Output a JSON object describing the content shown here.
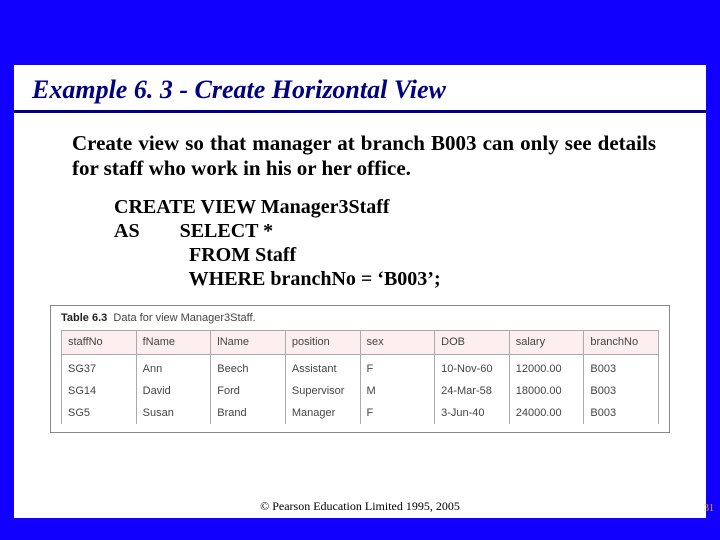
{
  "title": "Example 6. 3 - Create Horizontal View",
  "description": "Create view so that manager at branch B003 can only see details for staff who work in his or her office.",
  "code": {
    "l1": "CREATE VIEW Manager3Staff",
    "l2": "AS        SELECT *",
    "l3": "               FROM Staff",
    "l4": "               WHERE branchNo = ‘B003’;"
  },
  "table": {
    "caption_bold": "Table 6.3",
    "caption_rest": "Data for view Manager3Staff.",
    "headers": [
      "staffNo",
      "fName",
      "lName",
      "position",
      "sex",
      "DOB",
      "salary",
      "branchNo"
    ],
    "rows": [
      [
        "SG37",
        "Ann",
        "Beech",
        "Assistant",
        "F",
        "10-Nov-60",
        "12000.00",
        "B003"
      ],
      [
        "SG14",
        "David",
        "Ford",
        "Supervisor",
        "M",
        "24-Mar-58",
        "18000.00",
        "B003"
      ],
      [
        "SG5",
        "Susan",
        "Brand",
        "Manager",
        "F",
        "3-Jun-40",
        "24000.00",
        "B003"
      ]
    ]
  },
  "footer": "© Pearson Education Limited 1995, 2005",
  "page_number": "31"
}
